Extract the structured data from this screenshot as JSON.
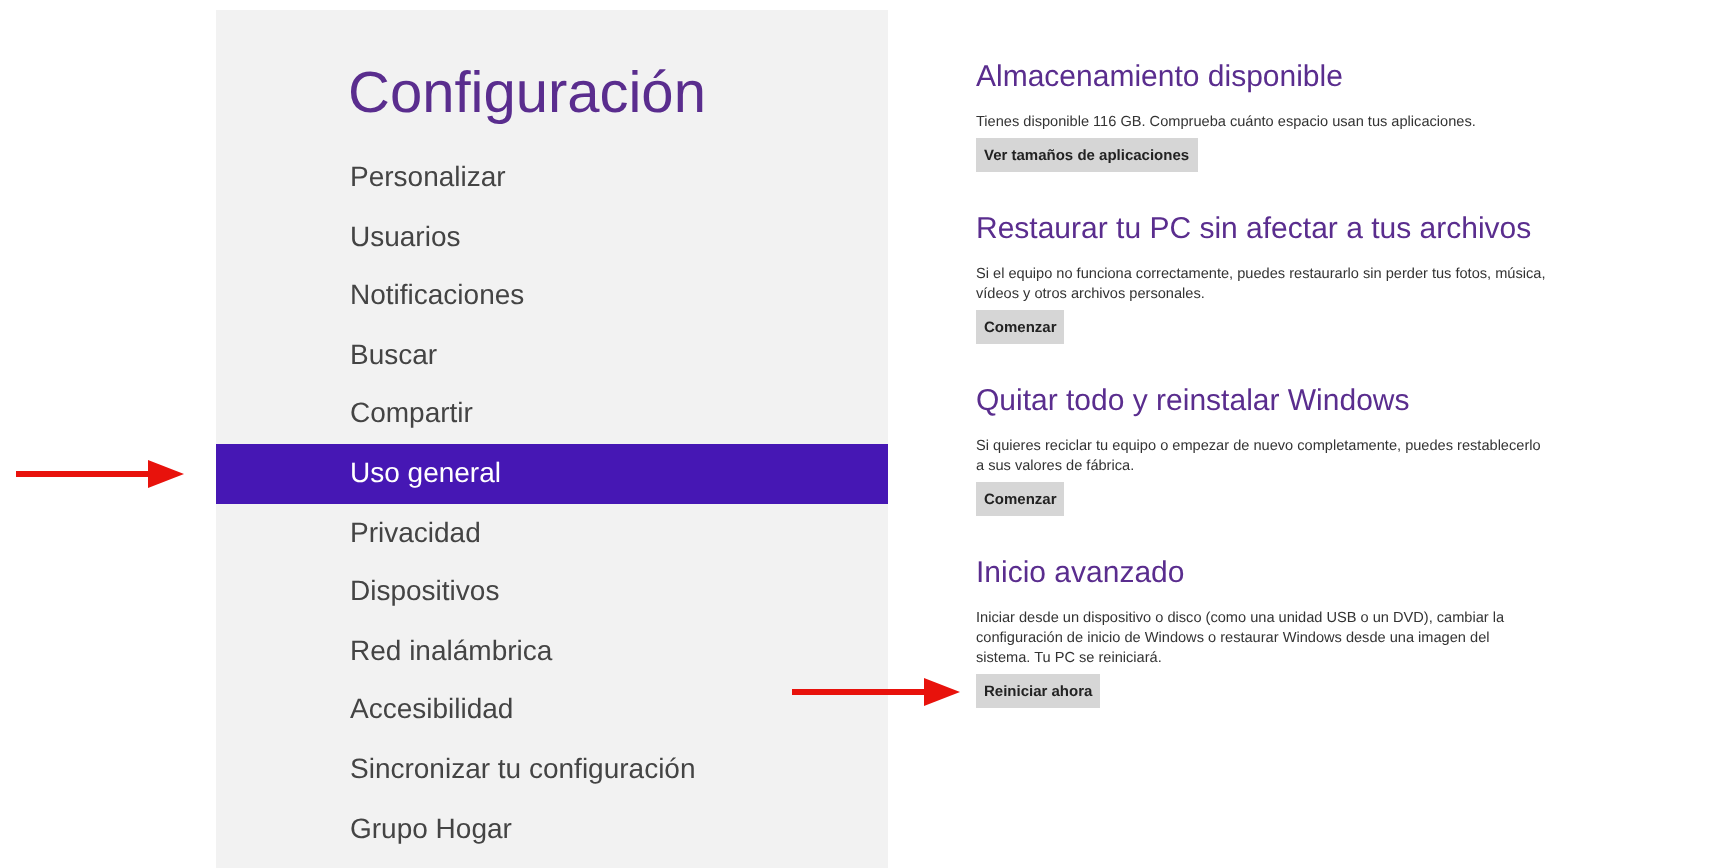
{
  "settings_menu": {
    "title": "Configuración",
    "items": [
      {
        "label": "Personalizar",
        "selected": false
      },
      {
        "label": "Usuarios",
        "selected": false
      },
      {
        "label": "Notificaciones",
        "selected": false
      },
      {
        "label": "Buscar",
        "selected": false
      },
      {
        "label": "Compartir",
        "selected": false
      },
      {
        "label": "Uso general",
        "selected": true
      },
      {
        "label": "Privacidad",
        "selected": false
      },
      {
        "label": "Dispositivos",
        "selected": false
      },
      {
        "label": "Red inalámbrica",
        "selected": false
      },
      {
        "label": "Accesibilidad",
        "selected": false
      },
      {
        "label": "Sincronizar tu configuración",
        "selected": false
      },
      {
        "label": "Grupo Hogar",
        "selected": false
      }
    ]
  },
  "sections": [
    {
      "heading": "Almacenamiento disponible",
      "text": "Tienes disponible 116 GB. Comprueba cuánto espacio usan tus aplicaciones.",
      "button": "Ver tamaños de aplicaciones",
      "arrow": false
    },
    {
      "heading": "Restaurar tu PC sin afectar a tus archivos",
      "text": "Si el equipo no funciona correctamente, puedes restaurarlo sin perder tus fotos, música, vídeos y otros archivos personales.",
      "button": "Comenzar",
      "arrow": false
    },
    {
      "heading": "Quitar todo y reinstalar Windows",
      "text": "Si quieres reciclar tu equipo o empezar de nuevo completamente, puedes restablecerlo a sus valores de fábrica.",
      "button": "Comenzar",
      "arrow": false
    },
    {
      "heading": "Inicio avanzado",
      "text": "Iniciar desde un dispositivo o disco (como una unidad USB o un DVD), cambiar la configuración de inicio de Windows o restaurar Windows desde una imagen del sistema. Tu PC se reiniciará.",
      "button": "Reiniciar ahora",
      "arrow": true
    }
  ]
}
